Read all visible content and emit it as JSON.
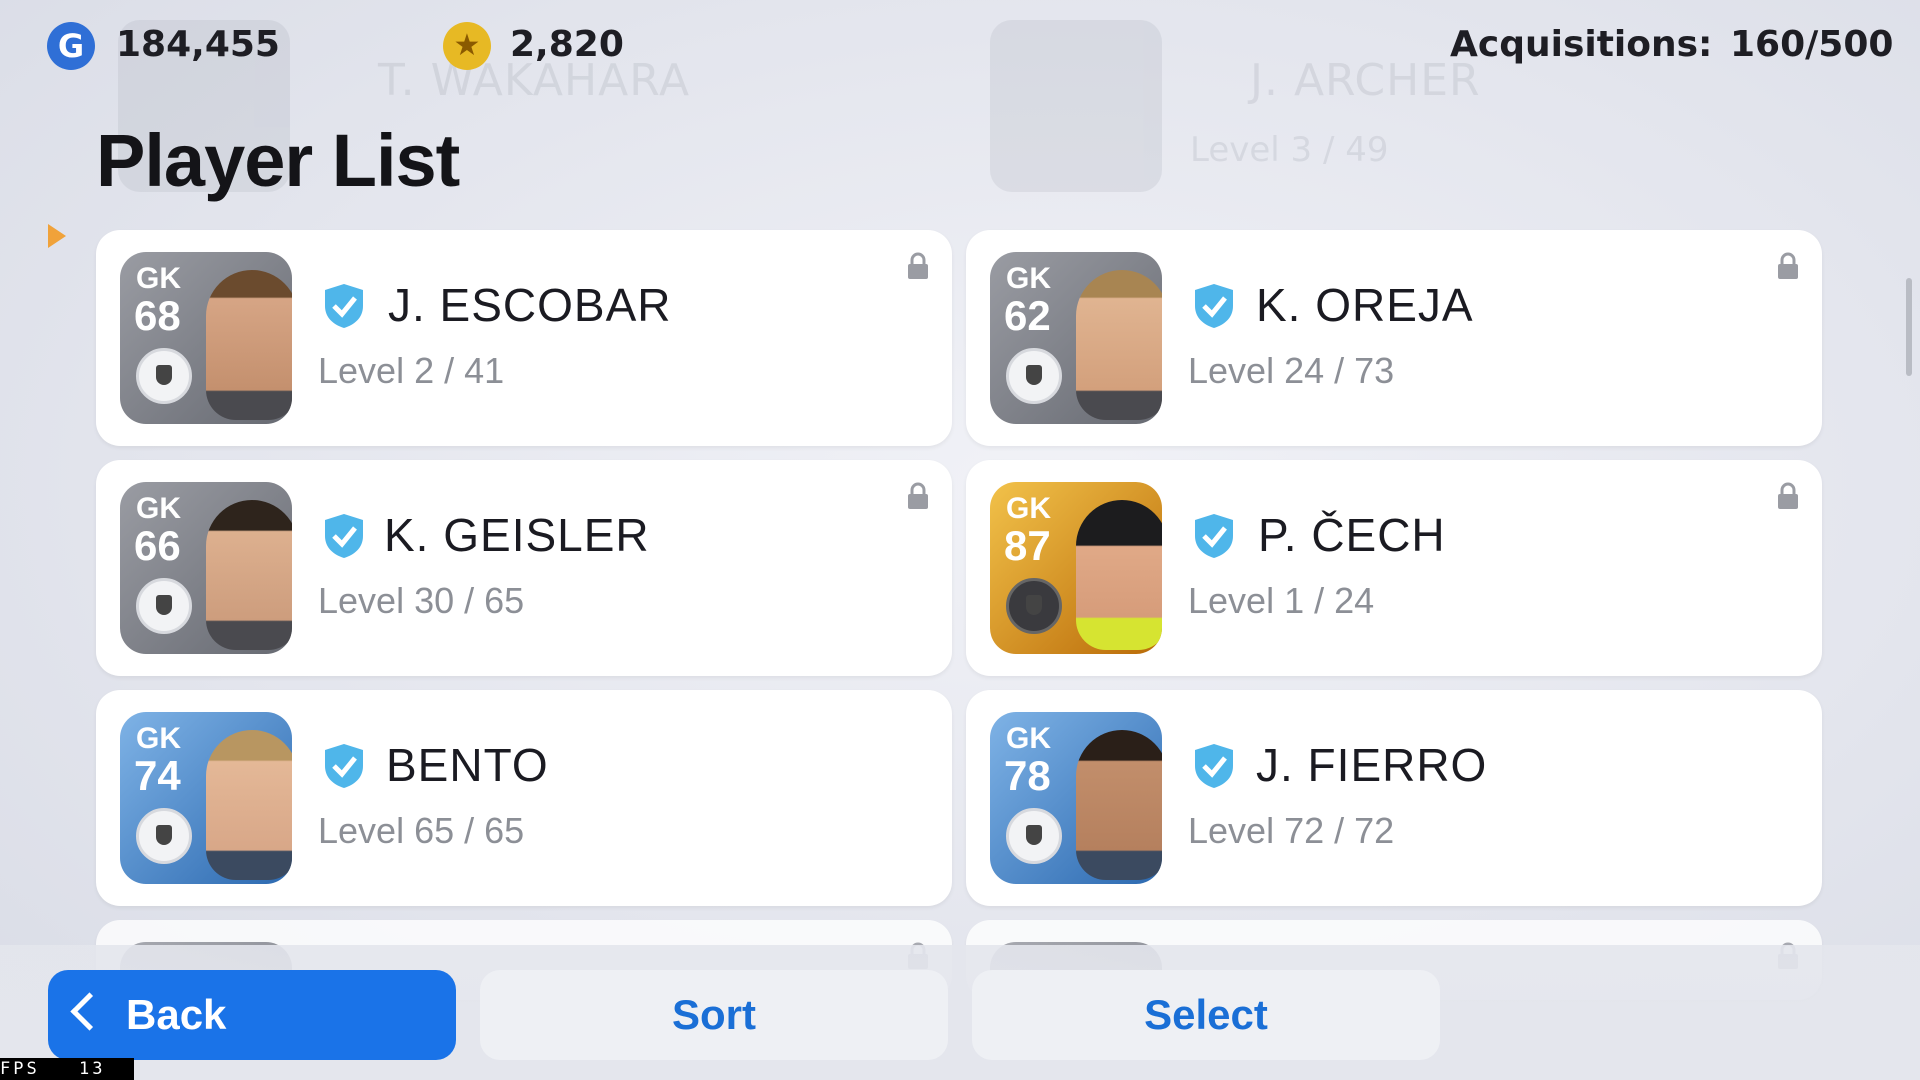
{
  "topbar": {
    "gp_value": "184,455",
    "coins_value": "2,820",
    "acquisitions_label": "Acquisitions:",
    "acquisitions_value": "160/500"
  },
  "title": "Player List",
  "background_rows": [
    {
      "name": "T. WAKAHARA"
    },
    {
      "name": "J. ARCHER",
      "level": "Level 3 / 49"
    }
  ],
  "players": [
    {
      "position": "GK",
      "rating": "68",
      "name": "J. ESCOBAR",
      "level": "Level 2 / 41",
      "locked": true,
      "card_style": "grey"
    },
    {
      "position": "GK",
      "rating": "62",
      "name": "K. OREJA",
      "level": "Level 24 / 73",
      "locked": true,
      "card_style": "grey"
    },
    {
      "position": "GK",
      "rating": "66",
      "name": "K. GEISLER",
      "level": "Level 30 / 65",
      "locked": true,
      "card_style": "grey"
    },
    {
      "position": "GK",
      "rating": "87",
      "name": "P. ČECH",
      "level": "Level 1 / 24",
      "locked": true,
      "card_style": "gold"
    },
    {
      "position": "GK",
      "rating": "74",
      "name": "BENTO",
      "level": "Level 65 / 65",
      "locked": false,
      "card_style": "blue"
    },
    {
      "position": "GK",
      "rating": "78",
      "name": "J. FIERRO",
      "level": "Level 72 / 72",
      "locked": false,
      "card_style": "blue"
    }
  ],
  "buttons": {
    "back": "Back",
    "sort": "Sort",
    "select": "Select"
  },
  "fps": {
    "label": "FPS",
    "value": "13"
  },
  "colors": {
    "accent": "#1a73e8",
    "verified": "#4fb6ea",
    "level_text": "#8c8f96"
  }
}
